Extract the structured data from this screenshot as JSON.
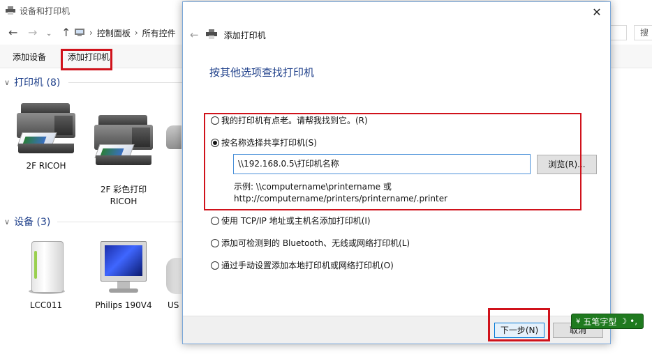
{
  "explorer": {
    "window_title": "设备和打印机",
    "breadcrumb": [
      "控制面板",
      "所有控件"
    ],
    "search_placeholder": "搜",
    "toolbar": {
      "add_device": "添加设备",
      "add_printer": "添加打印机"
    },
    "printers_group": "打印机 (8)",
    "printers": [
      "2F RICOH",
      "2F 彩色打印\nRICOH"
    ],
    "devices_group": "设备 (3)",
    "devices": [
      "LCC011",
      "Philips 190V4",
      "US"
    ]
  },
  "dialog": {
    "title": "添加打印机",
    "heading": "按其他选项查找打印机",
    "options": [
      {
        "label": "我的打印机有点老。请帮我找到它。(R)",
        "checked": false
      },
      {
        "label": "按名称选择共享打印机(S)",
        "checked": true
      },
      {
        "label": "使用 TCP/IP 地址或主机名添加打印机(I)",
        "checked": false
      },
      {
        "label": "添加可检测到的 Bluetooth、无线或网络打印机(L)",
        "checked": false
      },
      {
        "label": "通过手动设置添加本地打印机或网络打印机(O)",
        "checked": false
      }
    ],
    "printer_name_value": "\\\\192.168.0.5\\打印机名称",
    "browse_label": "浏览(R)...",
    "example_line1": "示例: \\\\computername\\printername 或",
    "example_line2": "http://computername/printers/printername/.printer",
    "next_label": "下一步(N)",
    "cancel_label": "取消"
  },
  "ime": {
    "label": "五笔字型"
  },
  "colors": {
    "highlight": "#d0121b",
    "heading_blue": "#1e3f8a"
  }
}
